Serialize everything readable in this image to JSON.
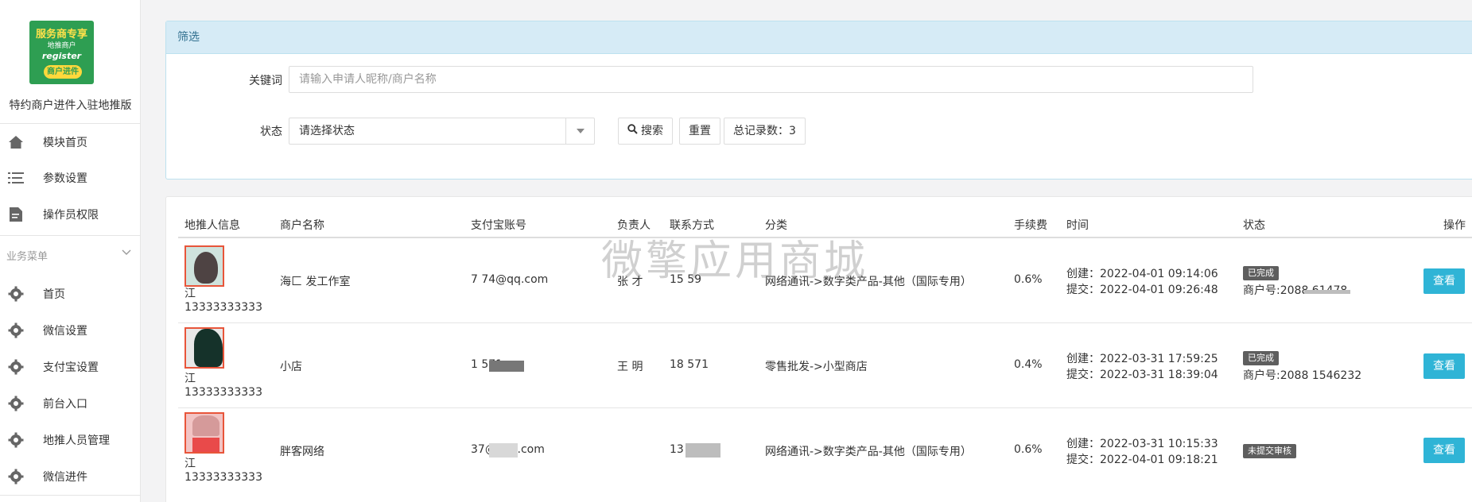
{
  "sidebar": {
    "logo": {
      "line1": "服务商专享",
      "line2": "地推商户",
      "line3": "register",
      "line4": "商户进件"
    },
    "app_title": "特约商户进件入驻地推版",
    "top_items": [
      {
        "label": "模块首页",
        "icon": "home-icon"
      },
      {
        "label": "参数设置",
        "icon": "list-icon"
      },
      {
        "label": "操作员权限",
        "icon": "document-icon"
      }
    ],
    "group_title": "业务菜单",
    "group_items": [
      {
        "label": "首页",
        "icon": "gear-icon"
      },
      {
        "label": "微信设置",
        "icon": "gear-icon"
      },
      {
        "label": "支付宝设置",
        "icon": "gear-icon"
      },
      {
        "label": "前台入口",
        "icon": "gear-icon"
      },
      {
        "label": "地推人员管理",
        "icon": "gear-icon"
      },
      {
        "label": "微信进件",
        "icon": "gear-icon"
      }
    ]
  },
  "filter": {
    "title": "筛选",
    "keyword_label": "关键词",
    "keyword_placeholder": "请输入申请人昵称/商户名称",
    "status_label": "状态",
    "status_select": "请选择状态",
    "search_button": "搜索",
    "reset_button": "重置",
    "total_label": "总记录数：3"
  },
  "table": {
    "headers": [
      "地推人信息",
      "商户名称",
      "支付宝账号",
      "负责人",
      "联系方式",
      "分类",
      "手续费",
      "时间",
      "状态",
      "操作"
    ],
    "rows": [
      {
        "promoter_name": "江",
        "promoter_phone": "13333333333",
        "merchant": "海匚             发工作室",
        "alipay": "7          74@qq.com",
        "owner": "张  才",
        "contact": "15          59",
        "category": "网络通讯->数字类产品-其他（国际专用）",
        "fee": "0.6%",
        "created": "创建：2022-04-01 09:14:06",
        "submitted": "提交：2022-04-01 09:26:48",
        "status": "已完成",
        "merchant_no": "商户号:2088            61478",
        "action": "查看"
      },
      {
        "promoter_name": "江",
        "promoter_phone": "13333333333",
        "merchant": "小店",
        "alipay": "1          571",
        "owner": "王  明",
        "contact": "18          571",
        "category": "零售批发->小型商店",
        "fee": "0.4%",
        "created": "创建：2022-03-31 17:59:25",
        "submitted": "提交：2022-03-31 18:39:04",
        "status": "已完成",
        "merchant_no": "商户号:2088        1546232",
        "action": "查看"
      },
      {
        "promoter_name": "江",
        "promoter_phone": "13333333333",
        "merchant": "胖客网络",
        "alipay": "        37@163.com",
        "owner": "",
        "contact": "13         227",
        "category": "网络通讯->数字类产品-其他（国际专用）",
        "fee": "0.6%",
        "created": "创建：2022-03-31 10:15:33",
        "submitted": "提交：2022-04-01 09:18:21",
        "status": "未提交审核",
        "merchant_no": "",
        "action": "查看"
      }
    ]
  },
  "watermark": "微擎应用商城",
  "colors": {
    "accent": "#2fb4d6",
    "filter_header_bg": "#d6ebf6",
    "filter_header_text": "#31708f",
    "badge_bg": "#5e5e5e"
  }
}
